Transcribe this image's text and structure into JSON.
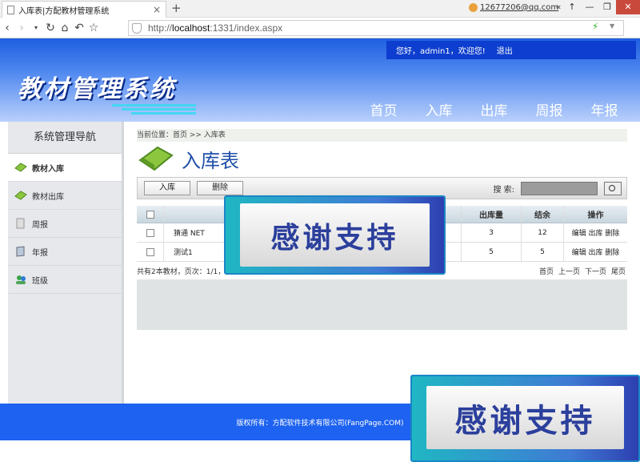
{
  "browser": {
    "tab_title": "入库表|方配教材管理系统",
    "tab_close": "×",
    "new_tab": "+",
    "user": "12677206@qq.com",
    "url_prefix": "http://",
    "url_host": "localhost",
    "url_rest": ":1331/index.aspx",
    "win_controls": [
      "«",
      "↑",
      "—",
      "❐",
      "✕"
    ]
  },
  "header": {
    "greeting": "您好，admin1，欢迎您!",
    "logout": "退出",
    "logo": "教材管理系统",
    "nav": [
      "首页",
      "入库",
      "出库",
      "周报",
      "年报"
    ],
    "accent": "#1d62f0"
  },
  "sidebar": {
    "title": "系统管理导航",
    "items": [
      {
        "label": "教材入库",
        "icon": "diamond-icon",
        "active": true
      },
      {
        "label": "教材出库",
        "icon": "diamond-icon",
        "active": false
      },
      {
        "label": "周报",
        "icon": "document-icon",
        "active": false
      },
      {
        "label": "年报",
        "icon": "book-icon",
        "active": false
      },
      {
        "label": "班级",
        "icon": "users-icon",
        "active": false
      }
    ]
  },
  "main": {
    "breadcrumb": "当前位置：首页 >> 入库表",
    "page_title": "入库表",
    "toolbar": {
      "add": "入库",
      "delete": "删除",
      "search_label": "搜  索:"
    },
    "table": {
      "headers": [
        "",
        "出库量",
        "结余",
        "操作"
      ],
      "rows": [
        {
          "name": "猜通 NET",
          "out": "3",
          "balance": "12",
          "actions": "编辑 出库 删除"
        },
        {
          "name": "测试1",
          "out": "5",
          "balance": "5",
          "actions": "编辑 出库 删除"
        }
      ],
      "summary": "共有2本教材，页次：1/1，10条/页",
      "pager": [
        "首页",
        "上一页",
        "下一页",
        "尾页"
      ]
    }
  },
  "footer": {
    "copyright": "版权所有：方配软件技术有限公司(FangPage.COM)"
  },
  "overlay": {
    "text": "感谢支持"
  }
}
